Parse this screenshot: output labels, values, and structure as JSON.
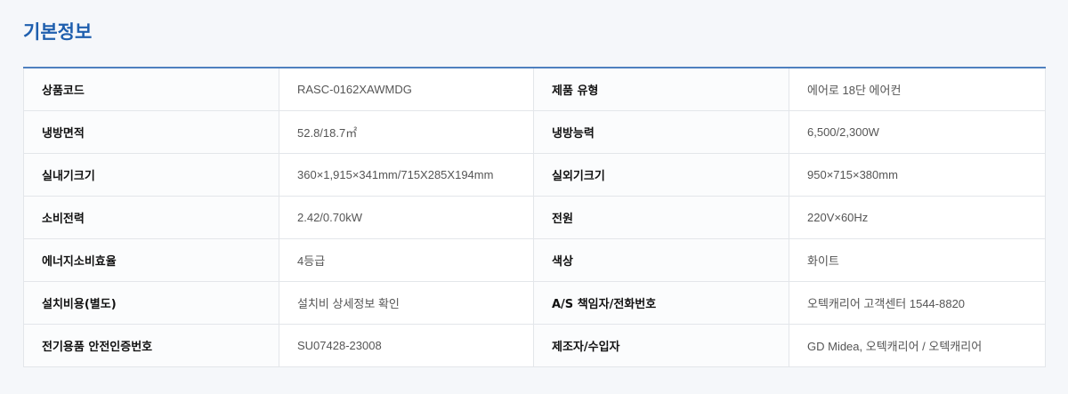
{
  "section": {
    "title": "기본정보"
  },
  "specs": [
    {
      "label1": "상품코드",
      "value1": "RASC-0162XAWMDG",
      "label2": "제품 유형",
      "value2": "에어로 18단 에어컨"
    },
    {
      "label1": "냉방면적",
      "value1": "52.8/18.7㎡",
      "label2": "냉방능력",
      "value2": "6,500/2,300W"
    },
    {
      "label1": "실내기크기",
      "value1": "360×1,915×341mm/715X285X194mm",
      "label2": "실외기크기",
      "value2": "950×715×380mm"
    },
    {
      "label1": "소비전력",
      "value1": "2.42/0.70kW",
      "label2": "전원",
      "value2": "220V×60Hz"
    },
    {
      "label1": "에너지소비효율",
      "value1": "4등급",
      "label2": "색상",
      "value2": "화이트"
    },
    {
      "label1": "설치비용(별도)",
      "value1": "설치비 상세정보 확인",
      "label2": "A/S 책임자/전화번호",
      "value2": "오텍캐리어 고객센터 1544-8820"
    },
    {
      "label1": "전기용품 안전인증번호",
      "value1": "SU07428-23008",
      "label2": "제조자/수입자",
      "value2": "GD Midea, 오텍캐리어 / 오텍캐리어"
    }
  ],
  "colors": {
    "title": "#1f5fae",
    "table_top_border": "#4e80bf",
    "background": "#f5f7fa"
  }
}
